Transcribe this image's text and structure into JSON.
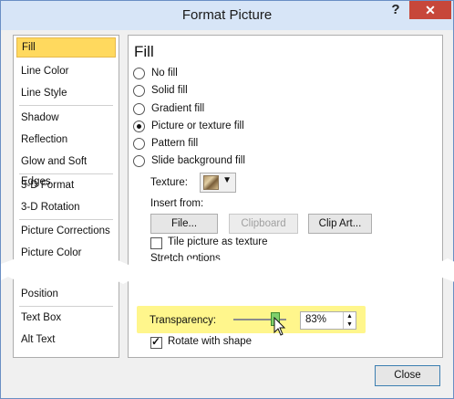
{
  "window": {
    "title": "Format Picture",
    "help_label": "?",
    "close_label": "✕"
  },
  "sidebar": {
    "items": [
      {
        "label": "Fill",
        "active": true
      },
      {
        "label": "Line Color"
      },
      {
        "label": "Line Style"
      },
      {
        "label": "Shadow"
      },
      {
        "label": "Reflection"
      },
      {
        "label": "Glow and Soft Edges"
      },
      {
        "label": "3-D Format"
      },
      {
        "label": "3-D Rotation"
      },
      {
        "label": "Picture Corrections"
      },
      {
        "label": "Picture Color"
      },
      {
        "label": "Position"
      },
      {
        "label": "Text Box"
      },
      {
        "label": "Alt Text"
      }
    ]
  },
  "fill": {
    "heading": "Fill",
    "options": [
      {
        "label": "No fill",
        "checked": false
      },
      {
        "label": "Solid fill",
        "checked": false
      },
      {
        "label": "Gradient fill",
        "checked": false
      },
      {
        "label": "Picture or texture fill",
        "checked": true
      },
      {
        "label": "Pattern fill",
        "checked": false
      },
      {
        "label": "Slide background fill",
        "checked": false
      }
    ],
    "texture_label": "Texture:",
    "insert_from_label": "Insert from:",
    "buttons": {
      "file": "File...",
      "clipboard": "Clipboard",
      "clip_art": "Clip Art..."
    },
    "tile_label": "Tile picture as texture",
    "tile_checked": false,
    "stretch_label": "Stretch options",
    "transparency_label": "Transparency:",
    "transparency_value": "83%",
    "transparency_fraction": 0.83,
    "rotate_label": "Rotate with shape",
    "rotate_checked": true
  },
  "footer": {
    "close_label": "Close"
  },
  "colors": {
    "selected_category": "#ffd95e",
    "highlight": "#fff68c",
    "slider_thumb": "#7fd06b",
    "close_button": "#c7473a"
  }
}
